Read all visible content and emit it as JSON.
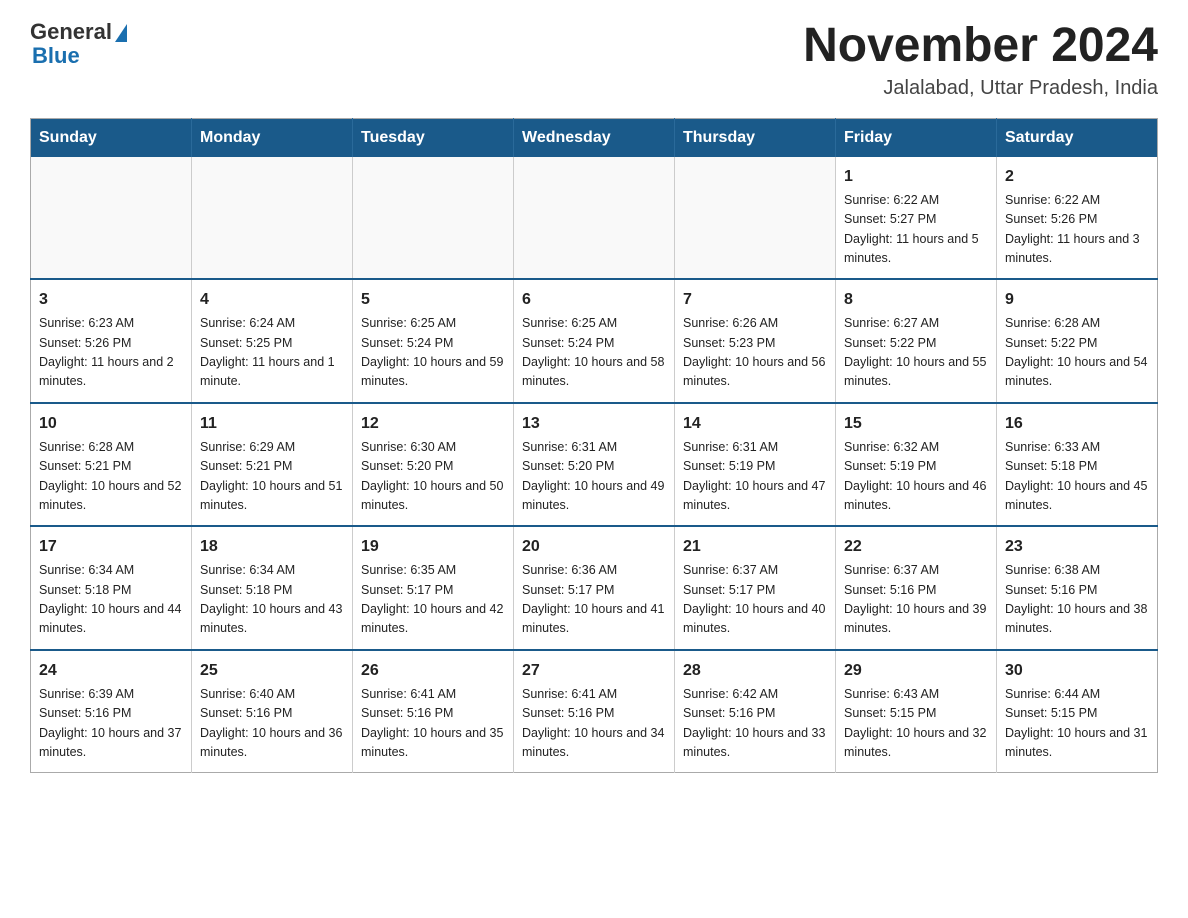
{
  "header": {
    "logo_line1": "General",
    "logo_line2": "Blue",
    "main_title": "November 2024",
    "subtitle": "Jalalabad, Uttar Pradesh, India"
  },
  "days_of_week": [
    "Sunday",
    "Monday",
    "Tuesday",
    "Wednesday",
    "Thursday",
    "Friday",
    "Saturday"
  ],
  "weeks": [
    [
      {
        "day": "",
        "info": ""
      },
      {
        "day": "",
        "info": ""
      },
      {
        "day": "",
        "info": ""
      },
      {
        "day": "",
        "info": ""
      },
      {
        "day": "",
        "info": ""
      },
      {
        "day": "1",
        "info": "Sunrise: 6:22 AM\nSunset: 5:27 PM\nDaylight: 11 hours and 5 minutes."
      },
      {
        "day": "2",
        "info": "Sunrise: 6:22 AM\nSunset: 5:26 PM\nDaylight: 11 hours and 3 minutes."
      }
    ],
    [
      {
        "day": "3",
        "info": "Sunrise: 6:23 AM\nSunset: 5:26 PM\nDaylight: 11 hours and 2 minutes."
      },
      {
        "day": "4",
        "info": "Sunrise: 6:24 AM\nSunset: 5:25 PM\nDaylight: 11 hours and 1 minute."
      },
      {
        "day": "5",
        "info": "Sunrise: 6:25 AM\nSunset: 5:24 PM\nDaylight: 10 hours and 59 minutes."
      },
      {
        "day": "6",
        "info": "Sunrise: 6:25 AM\nSunset: 5:24 PM\nDaylight: 10 hours and 58 minutes."
      },
      {
        "day": "7",
        "info": "Sunrise: 6:26 AM\nSunset: 5:23 PM\nDaylight: 10 hours and 56 minutes."
      },
      {
        "day": "8",
        "info": "Sunrise: 6:27 AM\nSunset: 5:22 PM\nDaylight: 10 hours and 55 minutes."
      },
      {
        "day": "9",
        "info": "Sunrise: 6:28 AM\nSunset: 5:22 PM\nDaylight: 10 hours and 54 minutes."
      }
    ],
    [
      {
        "day": "10",
        "info": "Sunrise: 6:28 AM\nSunset: 5:21 PM\nDaylight: 10 hours and 52 minutes."
      },
      {
        "day": "11",
        "info": "Sunrise: 6:29 AM\nSunset: 5:21 PM\nDaylight: 10 hours and 51 minutes."
      },
      {
        "day": "12",
        "info": "Sunrise: 6:30 AM\nSunset: 5:20 PM\nDaylight: 10 hours and 50 minutes."
      },
      {
        "day": "13",
        "info": "Sunrise: 6:31 AM\nSunset: 5:20 PM\nDaylight: 10 hours and 49 minutes."
      },
      {
        "day": "14",
        "info": "Sunrise: 6:31 AM\nSunset: 5:19 PM\nDaylight: 10 hours and 47 minutes."
      },
      {
        "day": "15",
        "info": "Sunrise: 6:32 AM\nSunset: 5:19 PM\nDaylight: 10 hours and 46 minutes."
      },
      {
        "day": "16",
        "info": "Sunrise: 6:33 AM\nSunset: 5:18 PM\nDaylight: 10 hours and 45 minutes."
      }
    ],
    [
      {
        "day": "17",
        "info": "Sunrise: 6:34 AM\nSunset: 5:18 PM\nDaylight: 10 hours and 44 minutes."
      },
      {
        "day": "18",
        "info": "Sunrise: 6:34 AM\nSunset: 5:18 PM\nDaylight: 10 hours and 43 minutes."
      },
      {
        "day": "19",
        "info": "Sunrise: 6:35 AM\nSunset: 5:17 PM\nDaylight: 10 hours and 42 minutes."
      },
      {
        "day": "20",
        "info": "Sunrise: 6:36 AM\nSunset: 5:17 PM\nDaylight: 10 hours and 41 minutes."
      },
      {
        "day": "21",
        "info": "Sunrise: 6:37 AM\nSunset: 5:17 PM\nDaylight: 10 hours and 40 minutes."
      },
      {
        "day": "22",
        "info": "Sunrise: 6:37 AM\nSunset: 5:16 PM\nDaylight: 10 hours and 39 minutes."
      },
      {
        "day": "23",
        "info": "Sunrise: 6:38 AM\nSunset: 5:16 PM\nDaylight: 10 hours and 38 minutes."
      }
    ],
    [
      {
        "day": "24",
        "info": "Sunrise: 6:39 AM\nSunset: 5:16 PM\nDaylight: 10 hours and 37 minutes."
      },
      {
        "day": "25",
        "info": "Sunrise: 6:40 AM\nSunset: 5:16 PM\nDaylight: 10 hours and 36 minutes."
      },
      {
        "day": "26",
        "info": "Sunrise: 6:41 AM\nSunset: 5:16 PM\nDaylight: 10 hours and 35 minutes."
      },
      {
        "day": "27",
        "info": "Sunrise: 6:41 AM\nSunset: 5:16 PM\nDaylight: 10 hours and 34 minutes."
      },
      {
        "day": "28",
        "info": "Sunrise: 6:42 AM\nSunset: 5:16 PM\nDaylight: 10 hours and 33 minutes."
      },
      {
        "day": "29",
        "info": "Sunrise: 6:43 AM\nSunset: 5:15 PM\nDaylight: 10 hours and 32 minutes."
      },
      {
        "day": "30",
        "info": "Sunrise: 6:44 AM\nSunset: 5:15 PM\nDaylight: 10 hours and 31 minutes."
      }
    ]
  ]
}
